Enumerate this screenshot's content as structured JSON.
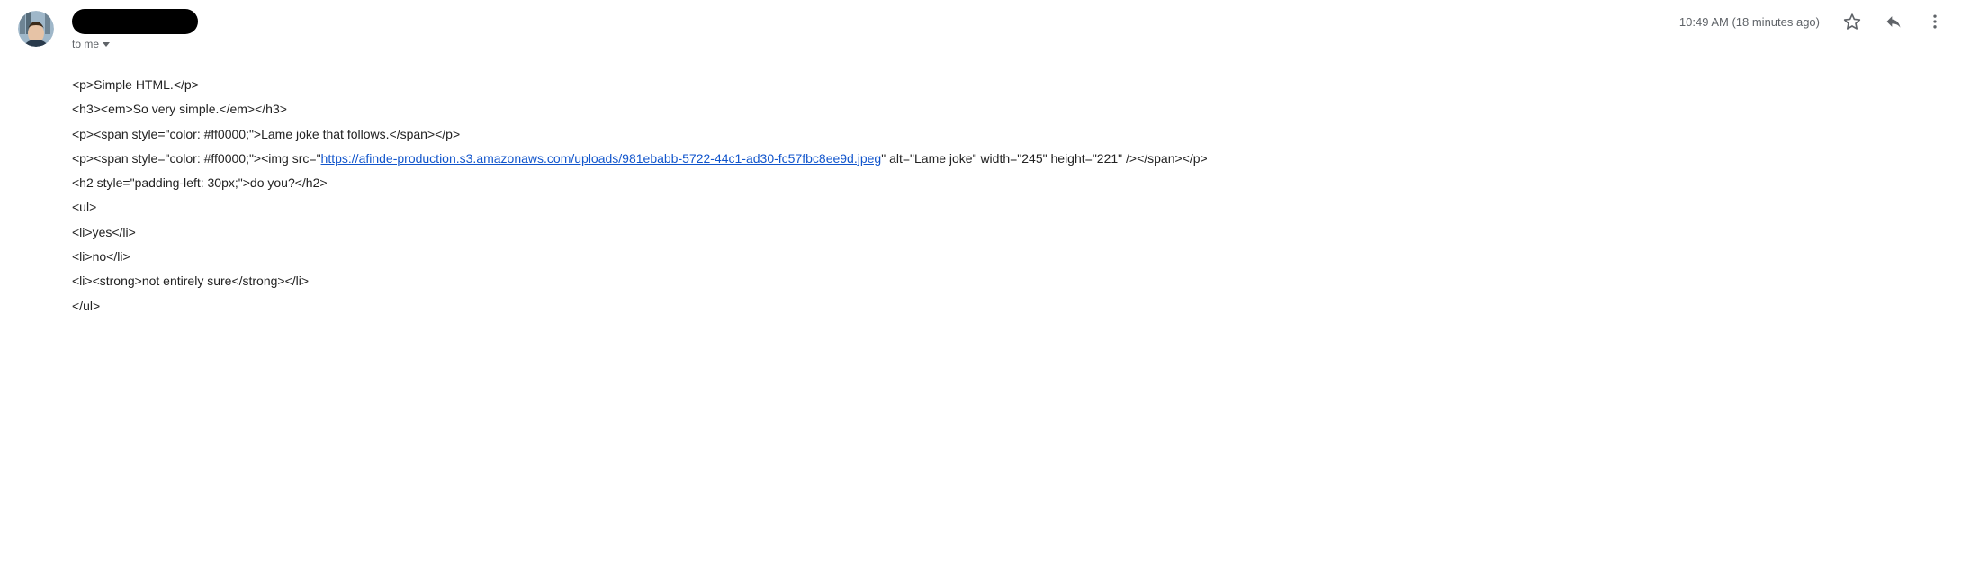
{
  "header": {
    "sender_name": "",
    "to_label": "to me",
    "timestamp": "10:49 AM (18 minutes ago)"
  },
  "body_lines": {
    "l1_a": "<p>Simple HTML.</p>",
    "l2_a": "<h3><em>So very simple.</em></h3>",
    "l3_a": "<p><span style=\"color: #ff0000;\">Lame joke that follows.</span></p>",
    "l4_a": "<p><span style=\"color: #ff0000;\"><img src=\"",
    "l4_link": "https://afinde-production.s3.amazonaws.com/uploads/981ebabb-5722-44c1-ad30-fc57fbc8ee9d.jpeg",
    "l4_b": "\" alt=\"Lame joke\" width=\"245\" height=\"221\" /></span></p>",
    "l5_a": "<h2 style=\"padding-left: 30px;\">do you?</h2>",
    "l6_a": "<ul>",
    "l7_a": "<li>yes</li>",
    "l8_a": "<li>no</li>",
    "l9_a": "<li><strong>not entirely sure</strong></li>",
    "l10_a": "</ul>"
  }
}
